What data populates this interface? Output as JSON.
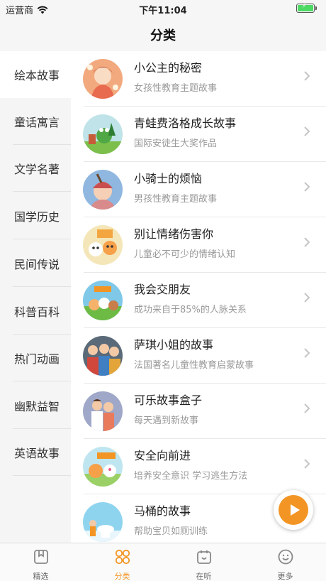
{
  "status_bar": {
    "carrier": "运营商",
    "time": "下午11:04",
    "wifi_icon": "wifi-icon",
    "battery_icon": "battery-charging-icon"
  },
  "nav": {
    "title": "分类"
  },
  "sidebar": {
    "active_index": 0,
    "items": [
      {
        "label": "绘本故事"
      },
      {
        "label": "童话寓言"
      },
      {
        "label": "文学名著"
      },
      {
        "label": "国学历史"
      },
      {
        "label": "民间传说"
      },
      {
        "label": "科普百科"
      },
      {
        "label": "热门动画"
      },
      {
        "label": "幽默益智"
      },
      {
        "label": "英语故事"
      }
    ]
  },
  "stories": [
    {
      "title": "小公主的秘密",
      "subtitle": "女孩性教育主题故事",
      "cover": "princess-cover"
    },
    {
      "title": "青蛙费洛格成长故事",
      "subtitle": "国际安徒生大奖作品",
      "cover": "frog-cover"
    },
    {
      "title": "小骑士的烦恼",
      "subtitle": "男孩性教育主题故事",
      "cover": "knight-cover"
    },
    {
      "title": "别让情绪伤害你",
      "subtitle": "儿童必不可少的情绪认知",
      "cover": "emotion-cover"
    },
    {
      "title": "我会交朋友",
      "subtitle": "成功来自于85%的人脉关系",
      "cover": "friends-cover"
    },
    {
      "title": "萨琪小姐的故事",
      "subtitle": "法国著名儿童性教育启蒙故事",
      "cover": "miss-saqi-cover"
    },
    {
      "title": "可乐故事盒子",
      "subtitle": "每天遇到新故事",
      "cover": "cola-cover"
    },
    {
      "title": "安全向前进",
      "subtitle": "培养安全意识 学习逃生方法",
      "cover": "safety-cover"
    },
    {
      "title": "马桶的故事",
      "subtitle": "帮助宝贝如厕训练",
      "cover": "toilet-cover"
    }
  ],
  "play_button": {
    "icon": "play-icon"
  },
  "tabbar": {
    "active_index": 1,
    "tabs": [
      {
        "label": "精选",
        "icon": "featured-icon"
      },
      {
        "label": "分类",
        "icon": "category-icon"
      },
      {
        "label": "在听",
        "icon": "listening-icon"
      },
      {
        "label": "更多",
        "icon": "more-icon"
      }
    ]
  },
  "colors": {
    "accent": "#f39524",
    "sidebar_bg": "#f5f5f5",
    "subtitle_text": "#9a9a9a"
  }
}
